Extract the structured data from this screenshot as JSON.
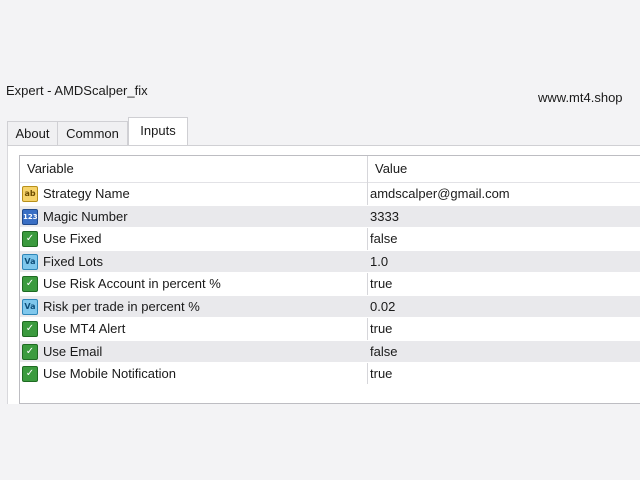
{
  "window": {
    "title": "Expert - AMDScalper_fix",
    "watermark": "www.mt4.shop"
  },
  "tabs": [
    {
      "label": "About",
      "active": false
    },
    {
      "label": "Common",
      "active": false
    },
    {
      "label": "Inputs",
      "active": true
    }
  ],
  "table": {
    "columns": [
      "Variable",
      "Value"
    ],
    "rows": [
      {
        "icon": "string-type-icon",
        "glyph": "ab",
        "variable": "Strategy Name",
        "value": "amdscalper@gmail.com"
      },
      {
        "icon": "integer-type-icon",
        "glyph": "123",
        "variable": "Magic Number",
        "value": "3333"
      },
      {
        "icon": "boolean-type-icon",
        "glyph": "✓",
        "variable": "Use Fixed",
        "value": "false"
      },
      {
        "icon": "double-type-icon",
        "glyph": "Va",
        "variable": "Fixed Lots",
        "value": "1.0"
      },
      {
        "icon": "boolean-type-icon",
        "glyph": "✓",
        "variable": "Use Risk Account in percent %",
        "value": "true"
      },
      {
        "icon": "double-type-icon",
        "glyph": "Va",
        "variable": "Risk per trade in percent %",
        "value": "0.02"
      },
      {
        "icon": "boolean-type-icon",
        "glyph": "✓",
        "variable": "Use MT4 Alert",
        "value": "true"
      },
      {
        "icon": "boolean-type-icon",
        "glyph": "✓",
        "variable": "Use Email",
        "value": "false"
      },
      {
        "icon": "boolean-type-icon",
        "glyph": "✓",
        "variable": "Use Mobile Notification",
        "value": "true"
      }
    ]
  },
  "colors": {
    "background": "#f3f3f5",
    "row_alt": "#e9e9ec",
    "boolean_icon": "#3b9b3e",
    "integer_icon": "#3a6fc4",
    "double_icon": "#7fc7ec",
    "string_icon": "#f6d36a"
  }
}
